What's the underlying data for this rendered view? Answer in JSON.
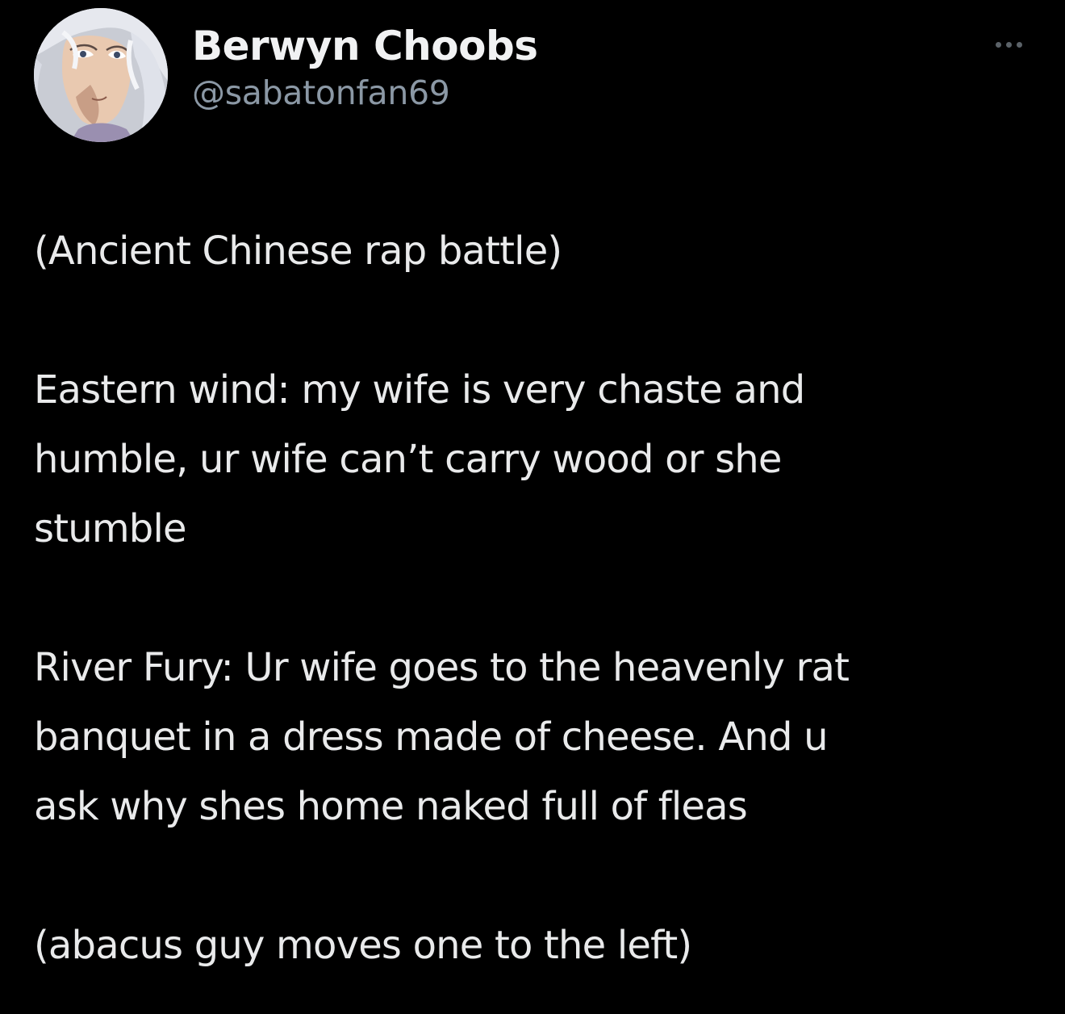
{
  "tweet": {
    "author": {
      "display_name": "Berwyn Choobs",
      "handle": "@sabatonfan69",
      "avatar_icon": "anime-character-avatar"
    },
    "more_icon": "more-options-icon",
    "paragraphs": [
      {
        "lines": [
          "(Ancient Chinese rap battle)"
        ]
      },
      {
        "lines": [
          "Eastern wind: my wife is very chaste and",
          "humble, ur wife can’t carry wood or she",
          "stumble"
        ]
      },
      {
        "lines": [
          "River Fury: Ur wife goes to the heavenly rat",
          "banquet in a dress made of cheese. And u",
          "ask why shes home naked full of fleas"
        ]
      },
      {
        "lines": [
          "(abacus guy moves one to the left)"
        ]
      }
    ]
  },
  "colors": {
    "background": "#000000",
    "text_primary": "#e7e9ea",
    "text_secondary": "#8b98a5"
  }
}
